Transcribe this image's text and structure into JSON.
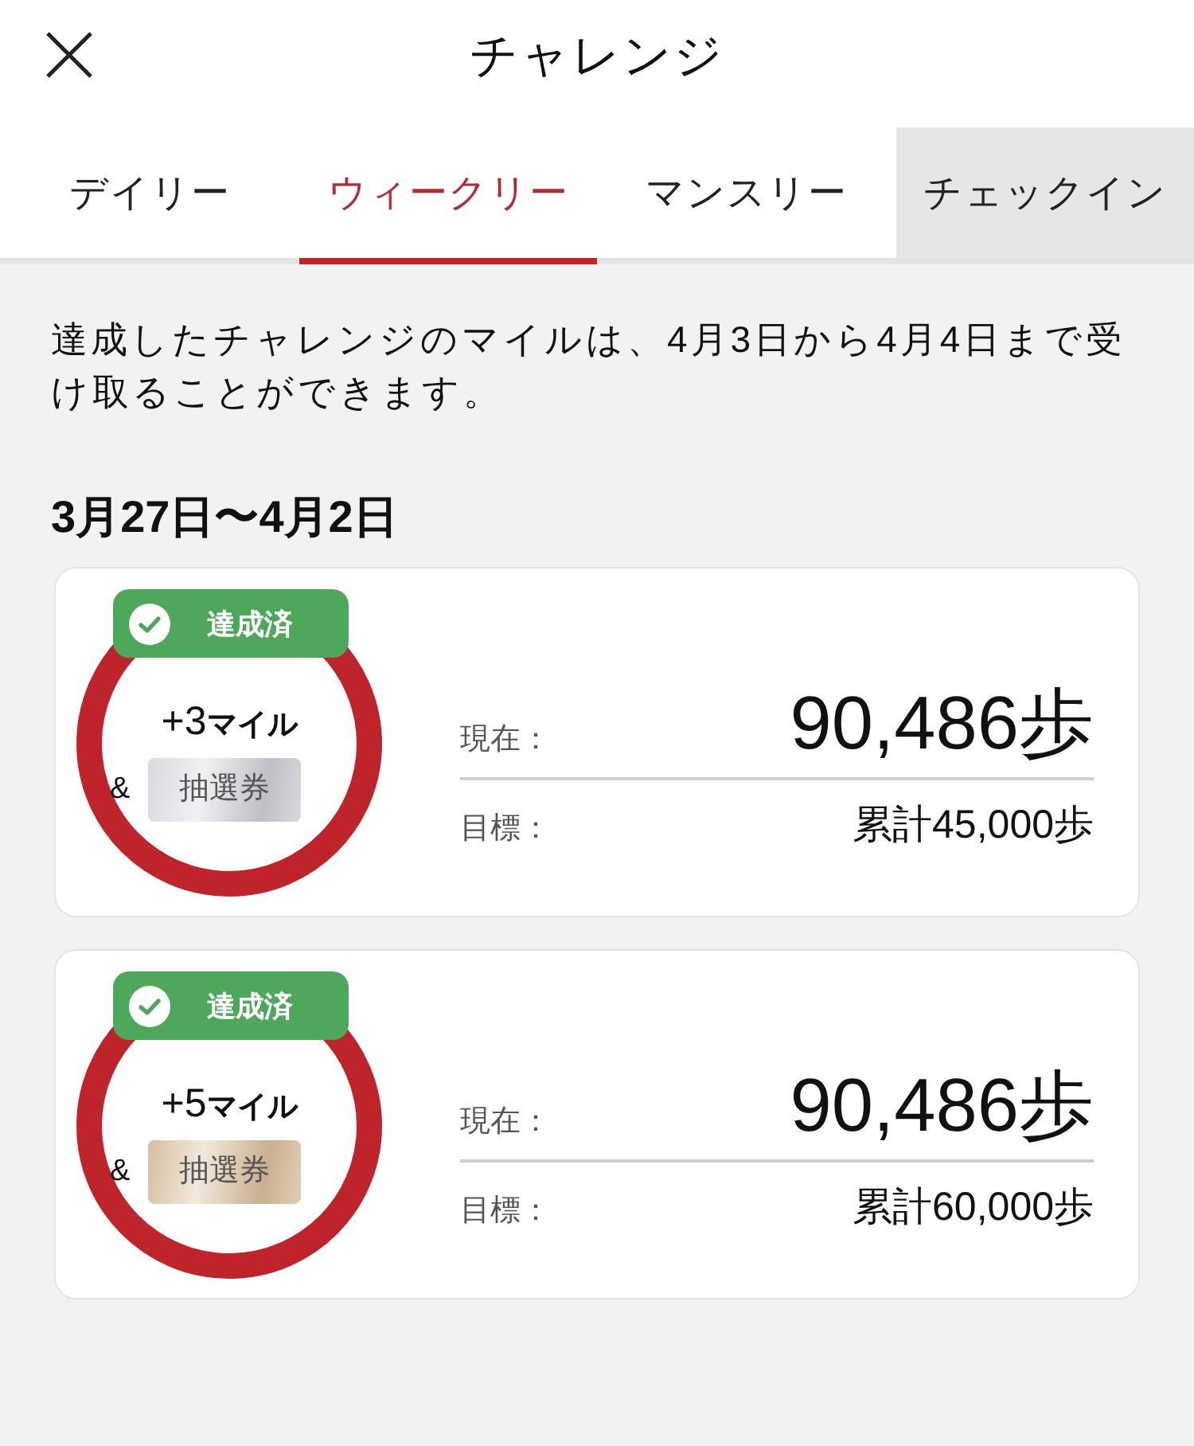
{
  "header": {
    "title": "チャレンジ"
  },
  "tabs": [
    {
      "label": "デイリー",
      "selected": false,
      "shaded": false
    },
    {
      "label": "ウィークリー",
      "selected": true,
      "shaded": false
    },
    {
      "label": "マンスリー",
      "selected": false,
      "shaded": false
    },
    {
      "label": "チェックイン",
      "selected": false,
      "shaded": true
    }
  ],
  "notice": "達成したチャレンジのマイルは、4月3日から4月4日まで受け取ることができます。",
  "period": "3月27日〜4月2日",
  "challenges": [
    {
      "badge": "達成済",
      "reward": "+3**マイル**",
      "connector": "&",
      "ticket": {
        "label": "抽選券",
        "kind": "silver"
      },
      "current_label": "現在：",
      "current_value": "90,486歩",
      "goal_label": "目標：",
      "goal_value": "累計45,000歩"
    },
    {
      "badge": "達成済",
      "reward": "+5**マイル**",
      "connector": "&",
      "ticket": {
        "label": "抽選券",
        "kind": "gold"
      },
      "current_label": "現在：",
      "current_value": "90,486歩",
      "goal_label": "目標：",
      "goal_value": "累計60,000歩"
    }
  ]
}
